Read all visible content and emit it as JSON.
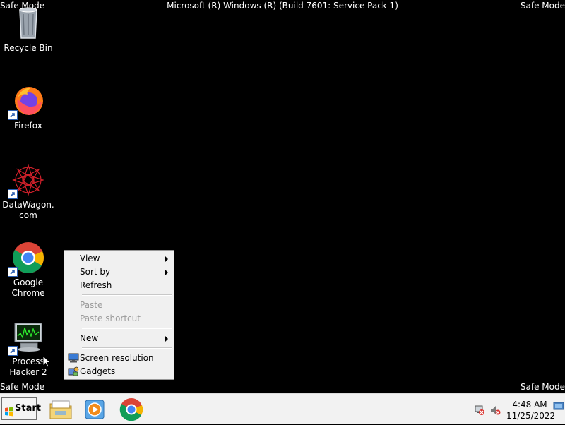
{
  "overlay": {
    "safe_mode": "Safe Mode",
    "title": "Microsoft (R) Windows (R) (Build 7601: Service Pack 1)"
  },
  "desktop_icons": [
    {
      "label": "Recycle Bin",
      "icon": "recycle-bin-icon"
    },
    {
      "label": "Firefox",
      "icon": "firefox-icon"
    },
    {
      "label": "DataWagon.com",
      "icon": "datawagon-icon"
    },
    {
      "label": "Google Chrome",
      "icon": "chrome-icon"
    },
    {
      "label": "Process Hacker 2",
      "icon": "process-hacker-icon"
    }
  ],
  "context_menu": {
    "items": [
      {
        "label": "View",
        "submenu": true,
        "enabled": true
      },
      {
        "label": "Sort by",
        "submenu": true,
        "enabled": true
      },
      {
        "label": "Refresh",
        "enabled": true
      },
      {
        "label": "Paste",
        "enabled": false
      },
      {
        "label": "Paste shortcut",
        "enabled": false
      },
      {
        "label": "New",
        "submenu": true,
        "enabled": true
      },
      {
        "label": "Screen resolution",
        "icon": "screen-resolution-icon",
        "enabled": true
      },
      {
        "label": "Gadgets",
        "icon": "gadgets-icon",
        "enabled": true
      }
    ]
  },
  "taskbar": {
    "start_label": "Start",
    "pinned": [
      "explorer-icon",
      "media-player-icon",
      "chrome-icon"
    ],
    "clock": {
      "time": "4:48 AM",
      "date": "11/25/2022"
    }
  },
  "colors": {
    "desktop": "#000000",
    "taskbar": "#f2f2f2",
    "menu": "#f0f0f0"
  }
}
